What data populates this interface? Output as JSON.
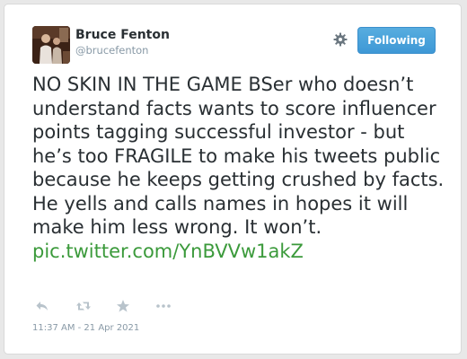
{
  "user": {
    "display_name": "Bruce Fenton",
    "handle": "@brucefenton"
  },
  "follow_button": {
    "label": "Following"
  },
  "tweet": {
    "text": "NO SKIN IN THE GAME BSer who doesn’t understand facts wants to score influencer points tagging successful investor - but he’s too FRAGILE to make his tweets public because he keeps getting crushed by facts. He yells and calls names in hopes it will make him less wrong. It won’t. ",
    "link": "pic.twitter.com/YnBVVw1akZ",
    "timestamp": "11:37 AM - 21 Apr 2021"
  },
  "icons": {
    "settings": "gear-icon",
    "reply": "reply-icon",
    "retweet": "retweet-icon",
    "favorite": "star-icon",
    "more": "more-icon"
  },
  "colors": {
    "text": "#292f33",
    "muted": "#8899a6",
    "link": "#3b9a3b",
    "button": "#4aa3df",
    "action_icon": "#b8c3cb"
  }
}
